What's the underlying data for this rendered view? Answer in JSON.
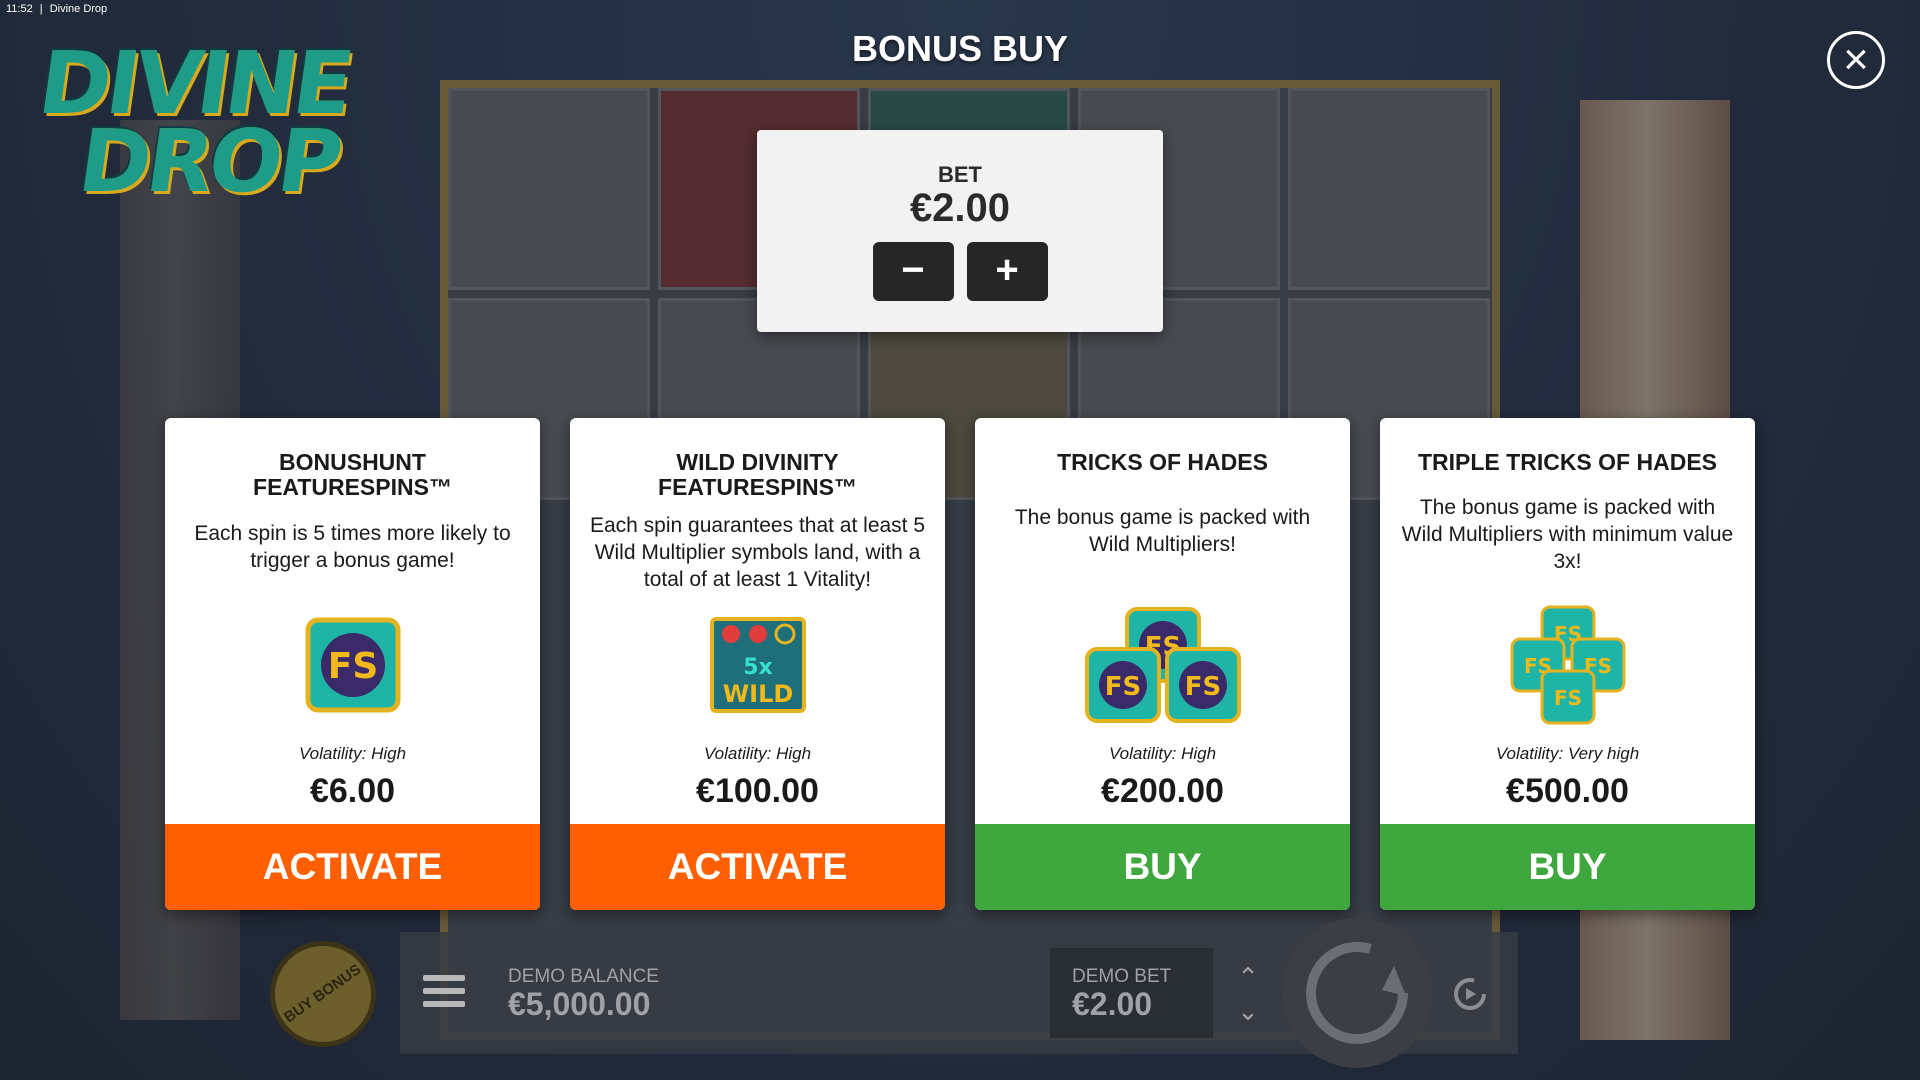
{
  "statusbar": {
    "time": "11:52",
    "separator": "|",
    "app_name": "Divine Drop"
  },
  "logo": {
    "line1": "DIVINE",
    "line2": "DROP"
  },
  "header": {
    "title": "BONUS BUY",
    "close_icon": "close-icon"
  },
  "bet": {
    "label": "BET",
    "value": "€2.00",
    "decrease_label": "−",
    "increase_label": "+"
  },
  "cards": [
    {
      "title": "BONUSHUNT FEATURESPINS™",
      "description": "Each spin is 5 times more likely to trigger a bonus game!",
      "icon": "fs-symbol-icon",
      "volatility": "Volatility: High",
      "price": "€6.00",
      "button": "ACTIVATE",
      "button_color": "#ff5f00"
    },
    {
      "title": "WILD DIVINITY FEATURESPINS™",
      "description": "Each spin guarantees that at least 5 Wild Multiplier symbols land, with a total of at least 1 Vitality!",
      "icon": "wild-multiplier-icon",
      "icon_text": "5x",
      "icon_subtext": "WILD",
      "volatility": "Volatility: High",
      "price": "€100.00",
      "button": "ACTIVATE",
      "button_color": "#ff5f00"
    },
    {
      "title": "TRICKS OF HADES",
      "description": "The bonus game is packed with Wild Multipliers!",
      "icon": "triple-fs-symbol-icon",
      "volatility": "Volatility: High",
      "price": "€200.00",
      "button": "BUY",
      "button_color": "#3ea73e"
    },
    {
      "title": "TRIPLE TRICKS OF HADES",
      "description": "The bonus game is packed with Wild Multipliers with minimum value 3x!",
      "icon": "quad-fs-symbol-icon",
      "volatility": "Volatility: Very high",
      "price": "€500.00",
      "button": "BUY",
      "button_color": "#3ea73e"
    }
  ],
  "bottom_bar": {
    "buy_bonus_label": "BUY BONUS",
    "menu_icon": "menu-icon",
    "balance_label": "DEMO BALANCE",
    "balance_value": "€5,000.00",
    "bet_label": "DEMO BET",
    "bet_value": "€2.00",
    "spin_icon": "spin-icon",
    "autoplay_icon": "autoplay-icon"
  }
}
